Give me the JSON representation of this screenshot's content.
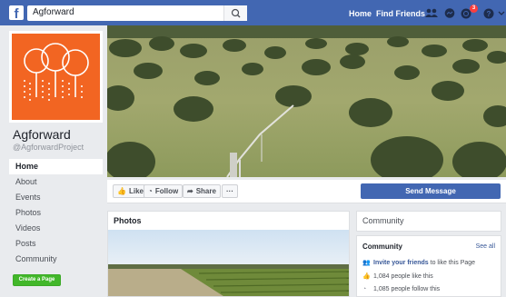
{
  "topbar": {
    "logo": "f",
    "search_value": "Agforward",
    "nav": {
      "home": "Home",
      "find_friends": "Find Friends"
    },
    "notification_count": "3"
  },
  "page": {
    "name": "Agforward",
    "handle": "@AgforwardProject"
  },
  "sidebar": {
    "items": [
      {
        "label": "Home"
      },
      {
        "label": "About"
      },
      {
        "label": "Events"
      },
      {
        "label": "Photos"
      },
      {
        "label": "Videos"
      },
      {
        "label": "Posts"
      },
      {
        "label": "Community"
      }
    ],
    "create_page": "Create a Page"
  },
  "actions": {
    "like": "Like",
    "follow": "Follow",
    "share": "Share",
    "more": "···",
    "send_message": "Send Message"
  },
  "photos": {
    "title": "Photos"
  },
  "community": {
    "header": "Community",
    "title": "Community",
    "see_all": "See all",
    "invite_link": "Invite your friends",
    "invite_suffix": " to like this Page",
    "likes": "1,084 people like this",
    "follows": "1,085 people follow this"
  },
  "colors": {
    "brand_blue": "#4267b2",
    "profile_orange": "#f26522",
    "create_green": "#42b72a"
  }
}
